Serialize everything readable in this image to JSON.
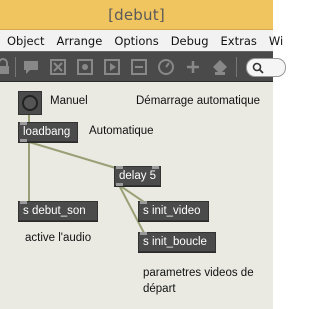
{
  "window": {
    "title": "[debut]"
  },
  "menubar": {
    "items": [
      "Object",
      "Arrange",
      "Options",
      "Debug",
      "Extras",
      "Wi"
    ]
  },
  "toolbar": {
    "icons": [
      "lock-icon",
      "comment-icon",
      "close-box-icon",
      "object-icon",
      "presentation-icon",
      "minimize-icon",
      "clock-icon",
      "add-icon",
      "paint-bucket-icon",
      "search-icon"
    ]
  },
  "patch": {
    "objects": {
      "loadbang": "loadbang",
      "delay": "delay 5",
      "send_debut_son": "s debut_son",
      "send_init_video": "s init_video",
      "send_init_boucle": "s init_boucle"
    },
    "comments": {
      "manuel": "Manuel",
      "demarrage": "Démarrage automatique",
      "automatique": "Automatique",
      "active_audio": "active l'audio",
      "parametres": "parametres videos de départ"
    }
  },
  "colors": {
    "title_bar": "#f0c45e",
    "menu_bar": "#f2f2f2",
    "toolbar": "#4a4a4a",
    "canvas": "#eaeae3",
    "object_box": "#4b4b4b",
    "patch_cord": "#9aa076"
  }
}
